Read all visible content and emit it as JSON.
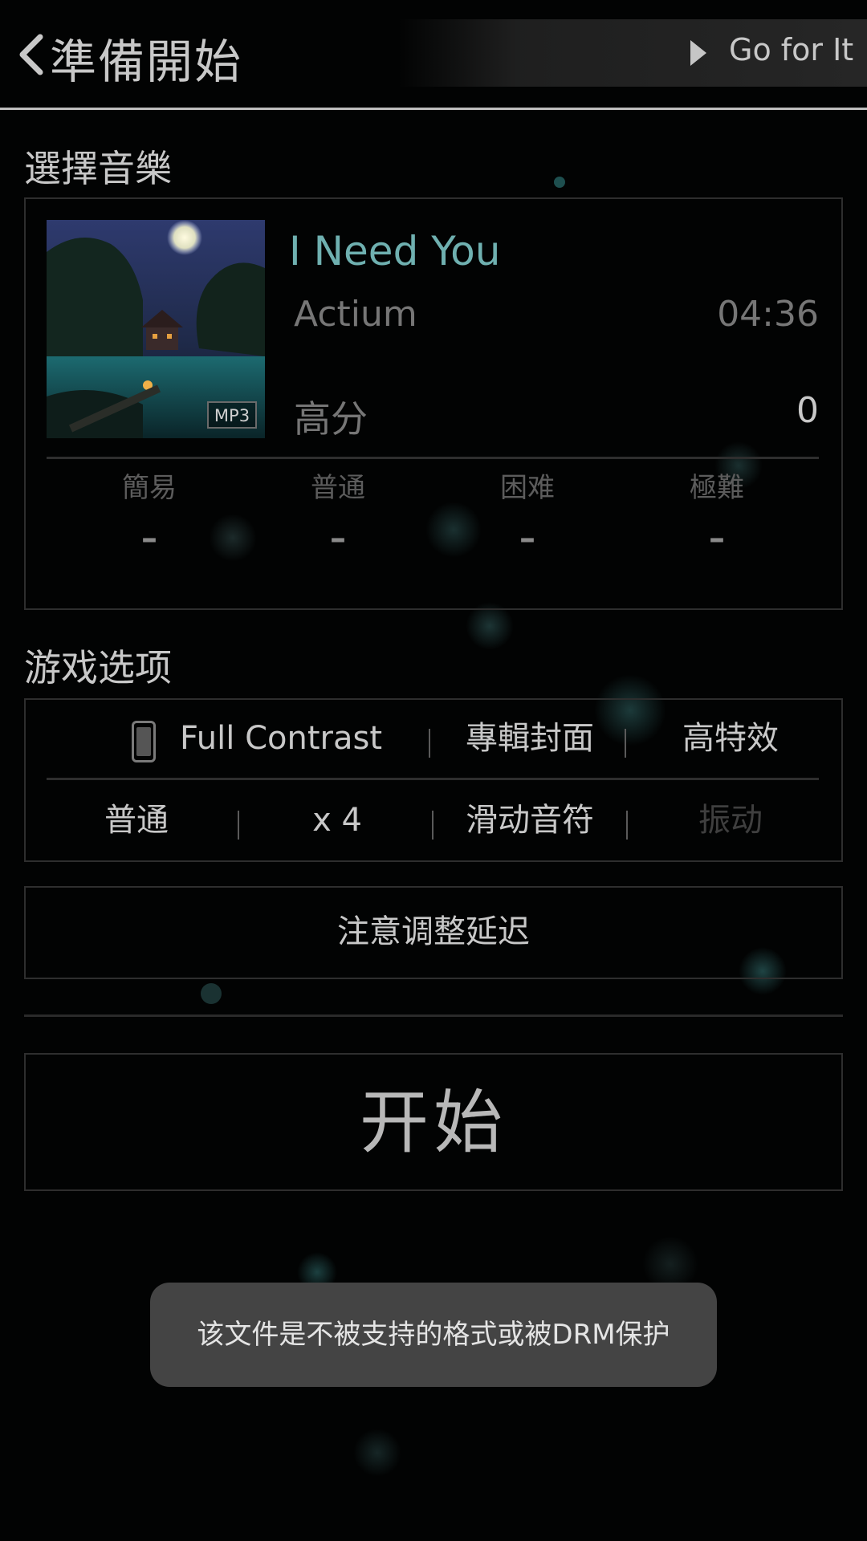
{
  "header": {
    "title": "準備開始",
    "go_label": "Go for It"
  },
  "song_section": {
    "label": "選擇音樂",
    "song": {
      "title": "I Need You",
      "artist": "Actium",
      "duration": "04:36",
      "format_badge": "MP3",
      "high_score_label": "高分",
      "high_score_value": "0"
    },
    "difficulties": [
      {
        "name": "簡易",
        "score": "–"
      },
      {
        "name": "普通",
        "score": "–"
      },
      {
        "name": "困难",
        "score": "–"
      },
      {
        "name": "極難",
        "score": "–"
      }
    ]
  },
  "options_section": {
    "label": "游戏选项",
    "row1": {
      "theme": "Full Contrast",
      "album_cover": "專輯封面",
      "high_effects": "高特效"
    },
    "row2": {
      "speed_mode": "普通",
      "multiplier": "x 4",
      "slide_notes": "滑动音符",
      "vibration": "振动"
    }
  },
  "latency_notice": "注意调整延迟",
  "start_button": "开始",
  "toast": "该文件是不被支持的格式或被DRM保护",
  "colors": {
    "accent_title": "#6fb0b0",
    "background": "#020303",
    "toast_bg": "#444444"
  },
  "icons": {
    "back": "chevron-left-icon",
    "go": "play-triangle-icon",
    "theme": "phone-icon"
  }
}
